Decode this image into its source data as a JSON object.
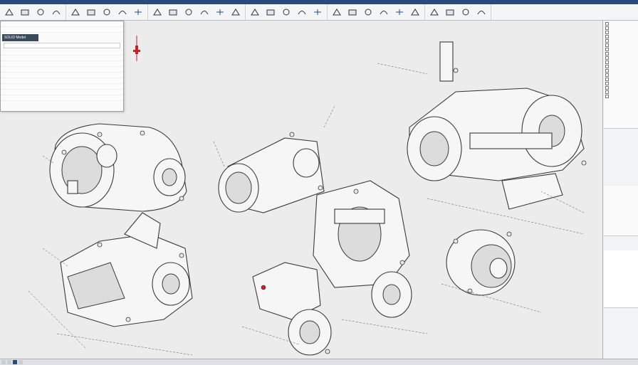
{
  "toolbar": {
    "groups": [
      {
        "buttons": [
          {
            "icon": "sketch-icon"
          },
          {
            "icon": "extrude-icon"
          },
          {
            "icon": "revolve-icon"
          },
          {
            "icon": "sweep-icon"
          }
        ]
      },
      {
        "buttons": [
          {
            "icon": "fillet-icon"
          },
          {
            "icon": "chamfer-icon"
          },
          {
            "icon": "shell-icon"
          },
          {
            "icon": "pattern-icon"
          },
          {
            "icon": "mirror-icon"
          }
        ]
      },
      {
        "buttons": [
          {
            "icon": "hole-icon"
          },
          {
            "icon": "rib-icon"
          },
          {
            "icon": "draft-icon"
          },
          {
            "icon": "plane-icon"
          },
          {
            "icon": "axis-icon"
          },
          {
            "icon": "point-icon"
          }
        ]
      },
      {
        "buttons": [
          {
            "icon": "assembly-icon"
          },
          {
            "icon": "mate-icon"
          },
          {
            "icon": "explode-icon"
          },
          {
            "icon": "section-icon"
          },
          {
            "icon": "measure-icon"
          }
        ]
      },
      {
        "buttons": [
          {
            "icon": "drawing-icon"
          },
          {
            "icon": "dimension-icon"
          },
          {
            "icon": "annotation-icon"
          },
          {
            "icon": "render-icon"
          },
          {
            "icon": "view-icon"
          },
          {
            "icon": "zoom-icon"
          }
        ]
      },
      {
        "buttons": [
          {
            "icon": "motion-icon"
          },
          {
            "icon": "simulation-icon"
          },
          {
            "icon": "export-icon"
          },
          {
            "icon": "options-icon"
          }
        ]
      }
    ]
  },
  "panel": {
    "header": "SOLID Model"
  },
  "colors": {
    "titlebar": "#2b4a78",
    "accent": "#c8202a",
    "canvas": "#ececec"
  }
}
